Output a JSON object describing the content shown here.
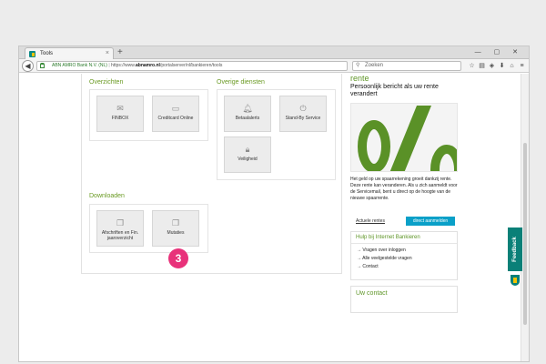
{
  "browser": {
    "tab_title": "Tools",
    "tab_close": "×",
    "new_tab": "+",
    "url_org": "ABN AMRO Bank N.V. (NL)",
    "url_prefix": "https://www.",
    "url_domain": "abnamro.nl",
    "url_path": "/portalserver/nl/bankieren/tools",
    "search_placeholder": "Zoeken",
    "window_controls": "— ▢ ✕"
  },
  "overzichten": {
    "title": "Overzichten",
    "tiles": [
      {
        "label": "FINBOX",
        "icon": "envelope-icon"
      },
      {
        "label": "Creditcard Online",
        "icon": "creditcard-icon"
      }
    ]
  },
  "overige": {
    "title": "Overige diensten",
    "tiles": [
      {
        "label": "Betaalalerts",
        "icon": "bell-icon"
      },
      {
        "label": "Stand-By Service",
        "icon": "power-icon"
      },
      {
        "label": "Veiligheid",
        "icon": "lock-icon"
      }
    ]
  },
  "downloaden": {
    "title": "Downloaden",
    "tiles": [
      {
        "label": "Afschriften en Fin. jaaroverzicht",
        "icon": "documents-icon"
      },
      {
        "label": "Mutaties",
        "icon": "documents-icon"
      }
    ]
  },
  "badge": "3",
  "rente": {
    "title": "rente",
    "subtitle": "Persoonlijk bericht als uw rente verandert",
    "body": "Het geld op uw spaarrekening groeit dankzij rente. Deze rente kan veranderen. Als u zich aanmeldt voor de Servicemail, bent u direct op de hoogte van de nieuwe spaarrente.",
    "link": "Actuele rentes",
    "button": "direct aanmelden"
  },
  "help": {
    "title": "Hulp bij Internet Bankieren",
    "items": [
      "→ Vragen over inloggen",
      "→ Alle veelgestelde vragen",
      "→ Contact"
    ]
  },
  "contact": {
    "title": "Uw contact"
  },
  "feedback": "Feedback",
  "colors": {
    "green": "#6a9a23",
    "teal": "#0a8078",
    "cyan": "#0aa0c8",
    "badge": "#e8327a"
  }
}
